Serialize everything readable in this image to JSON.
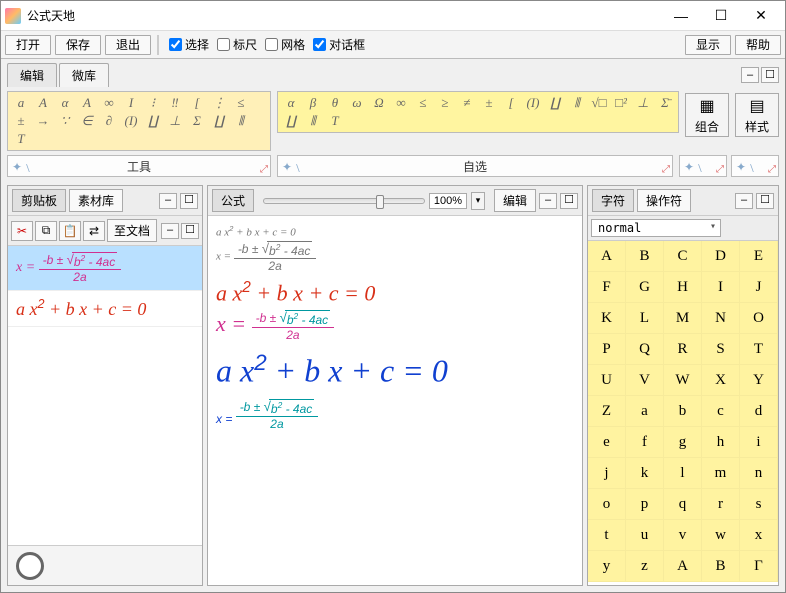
{
  "window": {
    "title": "公式天地"
  },
  "toolbar": {
    "open": "打开",
    "save": "保存",
    "exit": "退出",
    "select": "选择",
    "ruler": "标尺",
    "grid": "网格",
    "dialog": "对话框",
    "select_checked": true,
    "ruler_checked": false,
    "grid_checked": false,
    "dialog_checked": true,
    "display": "显示",
    "help": "帮助"
  },
  "main_tabs": {
    "edit": "编辑",
    "weiku": "微库"
  },
  "big_buttons": {
    "combine": "组合",
    "style": "样式"
  },
  "sym_palette_1": [
    "a",
    "A",
    "α",
    "Α",
    "∞",
    "Ι",
    "⁝",
    "‼",
    "[",
    "⋮",
    "≤",
    "±",
    "→",
    "∵",
    "∈",
    "∂",
    "(I)",
    "∐",
    "⊥",
    "Σ",
    "∐",
    "⦀",
    "T"
  ],
  "sym_palette_2": [
    "α",
    "β",
    "θ",
    "ω",
    "Ω",
    "∞",
    "≤",
    "≥",
    "≠",
    "±",
    "[",
    "(I)",
    "∐",
    "⦀",
    "√□",
    "□²",
    "⊥",
    "Σ̄",
    "∐",
    "⦀",
    "T"
  ],
  "sym_labels": {
    "tools": "工具",
    "custom": "自选"
  },
  "left_panel": {
    "tabs": {
      "clipboard": "剪贴板",
      "assets": "素材库"
    },
    "to_doc": "至文档",
    "items": [
      {
        "type": "fraction_magenta"
      },
      {
        "type": "quadratic_red"
      }
    ]
  },
  "center_panel": {
    "tab": "公式",
    "zoom": "100%",
    "edit_btn": "编辑",
    "formulas": [
      {
        "size": 11,
        "color": "#777",
        "kind": "quad"
      },
      {
        "size": 11,
        "color": "#777",
        "kind": "frac"
      },
      {
        "size": 20,
        "color": "#d83018",
        "kind": "quad"
      },
      {
        "size": 20,
        "color": "#d03090",
        "kind": "frac",
        "color_sqrt": "#0098a0"
      },
      {
        "size": 30,
        "color": "#1040d0",
        "kind": "quad"
      },
      {
        "size": 30,
        "color": "#0098a0",
        "kind": "frac",
        "color_x": "#1040d0"
      }
    ]
  },
  "right_panel": {
    "tabs": {
      "chars": "字符",
      "ops": "操作符"
    },
    "dropdown": "normal",
    "chars": [
      "A",
      "B",
      "C",
      "D",
      "E",
      "F",
      "G",
      "H",
      "I",
      "J",
      "K",
      "L",
      "M",
      "N",
      "O",
      "P",
      "Q",
      "R",
      "S",
      "T",
      "U",
      "V",
      "W",
      "X",
      "Y",
      "Z",
      "a",
      "b",
      "c",
      "d",
      "e",
      "f",
      "g",
      "h",
      "i",
      "j",
      "k",
      "l",
      "m",
      "n",
      "o",
      "p",
      "q",
      "r",
      "s",
      "t",
      "u",
      "v",
      "w",
      "x",
      "y",
      "z",
      "Α",
      "Β",
      "Γ"
    ]
  }
}
